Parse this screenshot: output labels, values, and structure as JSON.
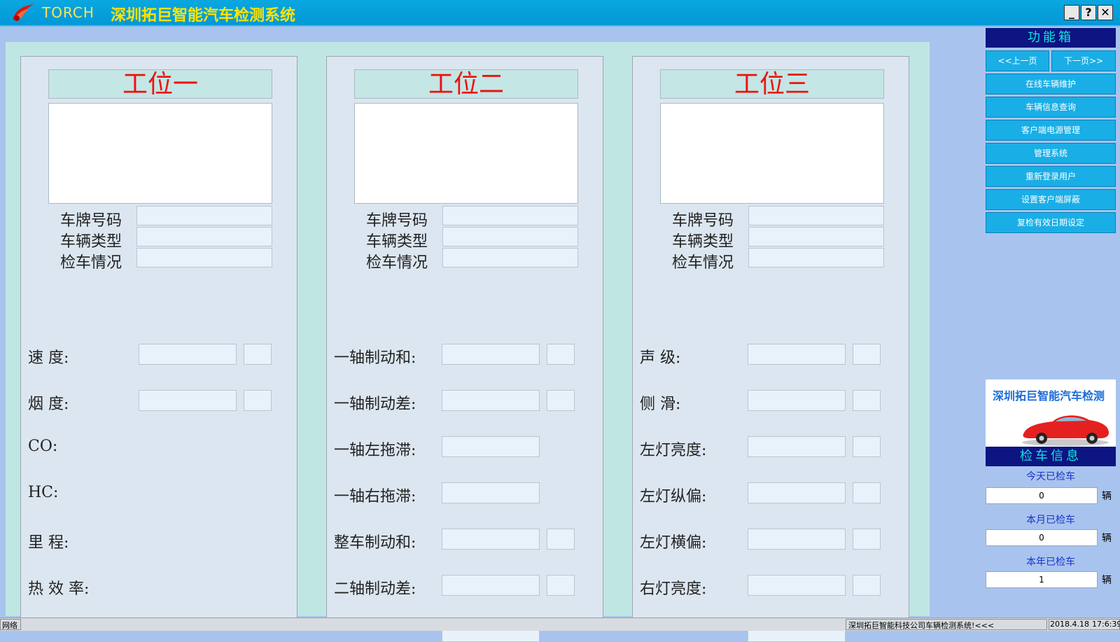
{
  "titlebar": {
    "brand": "TORCH",
    "title": "深圳拓巨智能汽车检测系统",
    "minimize": "_",
    "help": "?",
    "close": "✕"
  },
  "labels": {
    "plate": "车牌号码",
    "vehicle_type": "车辆类型",
    "inspection": "检车情况"
  },
  "stations": [
    {
      "title": "工位一",
      "metrics": [
        {
          "label": "速    度:",
          "fields": 2
        },
        {
          "label": "烟    度:",
          "fields": 2
        },
        {
          "label": "CO:",
          "fields": 0
        },
        {
          "label": "HC:",
          "fields": 0
        },
        {
          "label": "里    程:",
          "fields": 0
        },
        {
          "label": "热 效 率:",
          "fields": 0
        }
      ]
    },
    {
      "title": "工位二",
      "metrics": [
        {
          "label": "一轴制动和:",
          "fields": 2
        },
        {
          "label": "一轴制动差:",
          "fields": 2
        },
        {
          "label": "一轴左拖滞:",
          "fields": 1
        },
        {
          "label": "一轴右拖滞:",
          "fields": 1
        },
        {
          "label": "整车制动和:",
          "fields": 2
        },
        {
          "label": "二轴制动差:",
          "fields": 2
        }
      ]
    },
    {
      "title": "工位三",
      "metrics": [
        {
          "label": "声    级:",
          "fields": 2
        },
        {
          "label": "侧    滑:",
          "fields": 2
        },
        {
          "label": "左灯亮度:",
          "fields": 2
        },
        {
          "label": "左灯纵偏:",
          "fields": 2
        },
        {
          "label": "左灯横偏:",
          "fields": 2
        },
        {
          "label": "右灯亮度:",
          "fields": 2
        }
      ]
    }
  ],
  "sidebar": {
    "toolbox_title": "功能箱",
    "prev_page": "<<上一页",
    "next_page": "下一页>>",
    "buttons": [
      "在线车辆维护",
      "车辆信息查询",
      "客户端电源管理",
      "管理系统",
      "重新登录用户",
      "设置客户端屏蔽",
      "复检有效日期设定"
    ],
    "ad_text": "深圳拓巨智能汽车检测",
    "info_title": "检车信息",
    "stats": [
      {
        "label": "今天已检车",
        "value": "0",
        "unit": "辆"
      },
      {
        "label": "本月已检车",
        "value": "0",
        "unit": "辆"
      },
      {
        "label": "本年已检车",
        "value": "1",
        "unit": "辆"
      }
    ]
  },
  "status": {
    "left": "网络",
    "marquee": "深圳拓巨智能科技公司车辆检测系统!<<<",
    "date": "2018.4.18",
    "time": "17:6:39"
  }
}
